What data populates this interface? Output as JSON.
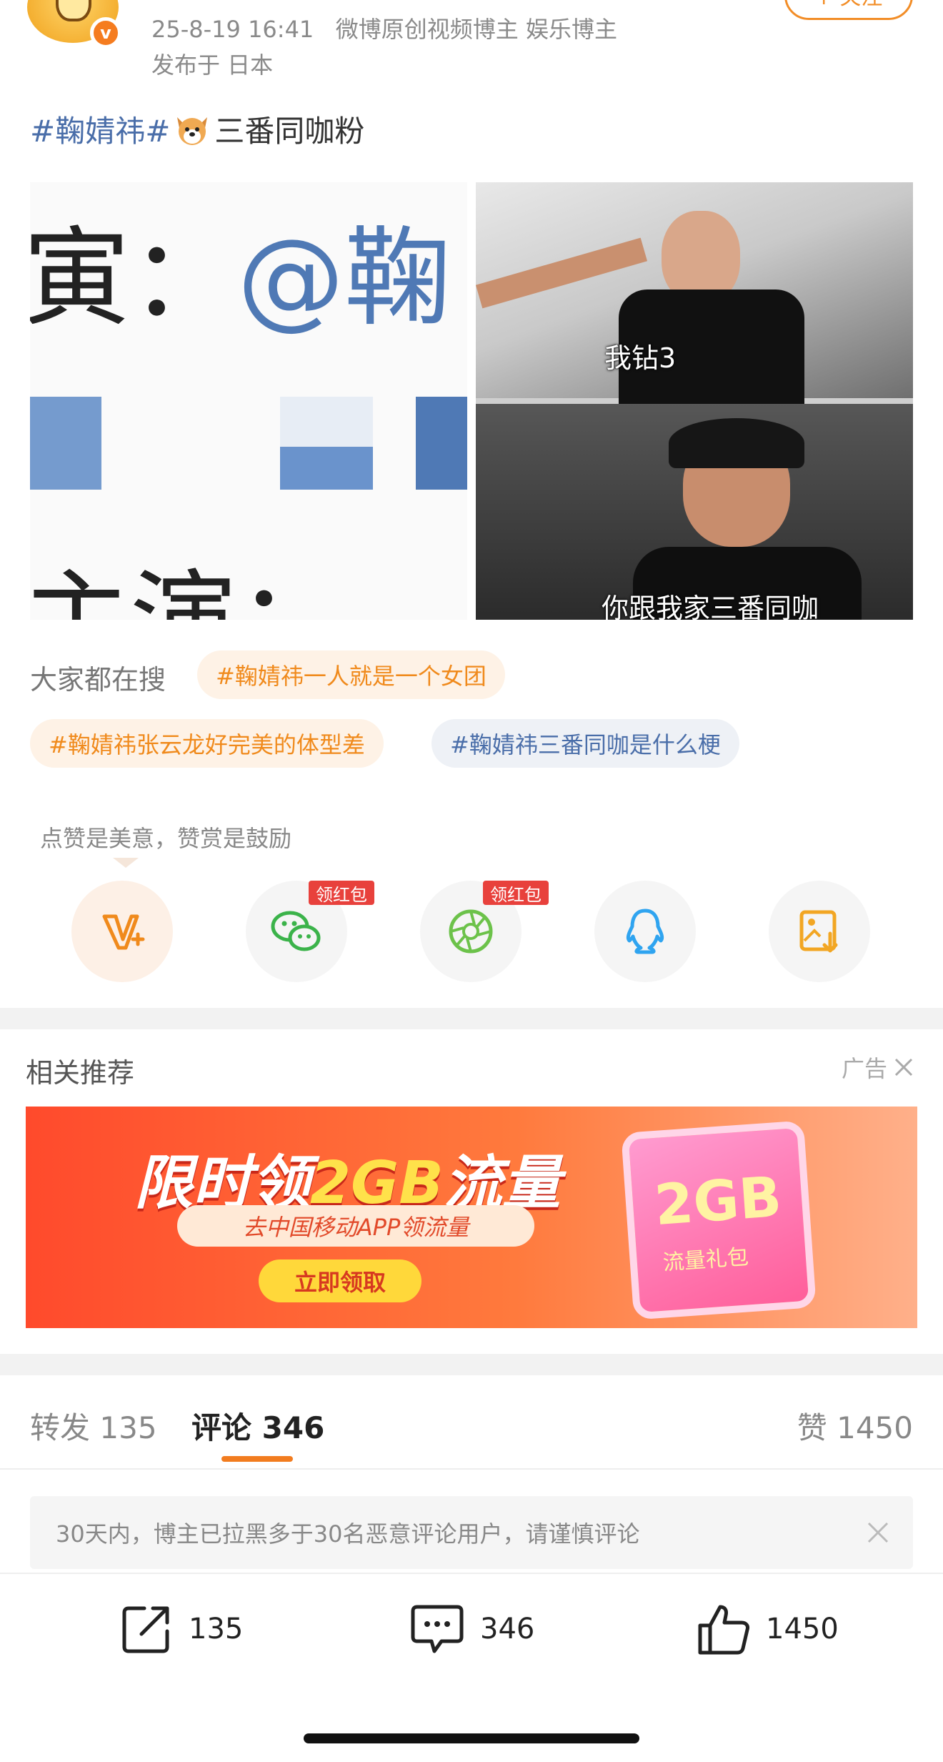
{
  "header": {
    "follow_label": "+ 关注",
    "date": "25-8-19 16:41",
    "roles": "微博原创视频博主 娱乐博主",
    "location": "发布于 日本",
    "verify_badge": "v"
  },
  "post": {
    "hashtag": "#鞠婧祎#",
    "text": "三番同咖粉"
  },
  "images": {
    "left_chars": [
      "寅：",
      "@鞠",
      "主演："
    ],
    "right_top_caption": "我钻3",
    "right_bottom_caption": "你跟我家三番同咖"
  },
  "hot_search": {
    "label": "大家都在搜",
    "chips": [
      {
        "text": "#鞠婧祎一人就是一个女团",
        "style": "orange"
      },
      {
        "text": "#鞠婧祎张云龙好完美的体型差",
        "style": "orange"
      },
      {
        "text": "#鞠婧祎三番同咖是什么梗",
        "style": "blue"
      }
    ]
  },
  "reward": {
    "hint": "点赞是美意，赞赏是鼓励",
    "redpack_label": "领红包",
    "icons": [
      "reward-v-icon",
      "wechat-icon",
      "moments-icon",
      "qq-icon",
      "save-image-icon"
    ]
  },
  "related": {
    "title": "相关推荐",
    "ad_label": "广告",
    "ad": {
      "headline_a": "限时领",
      "headline_b": "2GB",
      "headline_c": "流量",
      "sub": "去中国移动APP领流量",
      "button": "立即领取",
      "card_big": "2GB",
      "card_small": "流量礼包"
    }
  },
  "tabs": [
    {
      "label": "转发",
      "count": "135"
    },
    {
      "label": "评论",
      "count": "346"
    },
    {
      "label": "赞",
      "count": "1450"
    }
  ],
  "notice": "30天内，博主已拉黑多于30名恶意评论用户，请谨慎评论",
  "bottom_bar": {
    "repost_count": "135",
    "comment_count": "346",
    "like_count": "1450"
  },
  "colors": {
    "accent": "#f27c1f",
    "link": "#4a6ea9",
    "redpack": "#e8413c"
  }
}
